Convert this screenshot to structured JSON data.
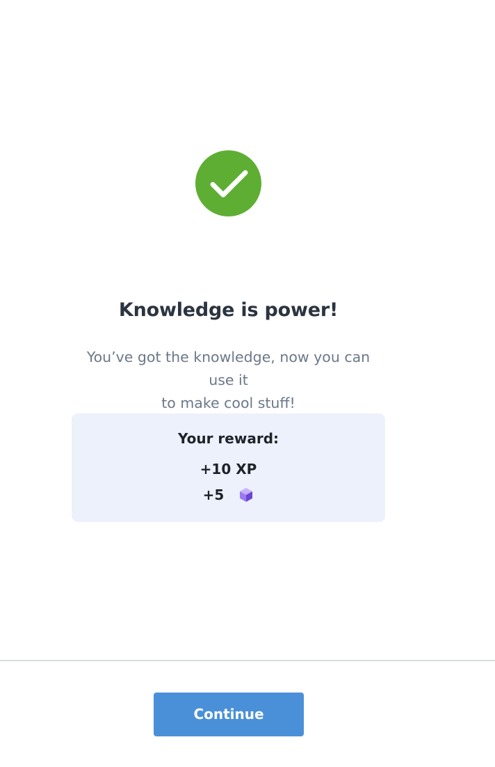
{
  "success": {
    "icon": "check-circle-icon",
    "color": "#5eae33"
  },
  "headline": "Knowledge is power!",
  "message": {
    "line1": "You’ve got the knowledge, now you can use it",
    "line2": "to make cool stuff!"
  },
  "reward": {
    "title": "Your reward:",
    "xp": "+10 XP",
    "gems": "+5",
    "gem_icon": "purple-cube-icon",
    "background": "#edf1fb"
  },
  "footer": {
    "continue_label": "Continue",
    "button_color": "#4a90d9"
  }
}
